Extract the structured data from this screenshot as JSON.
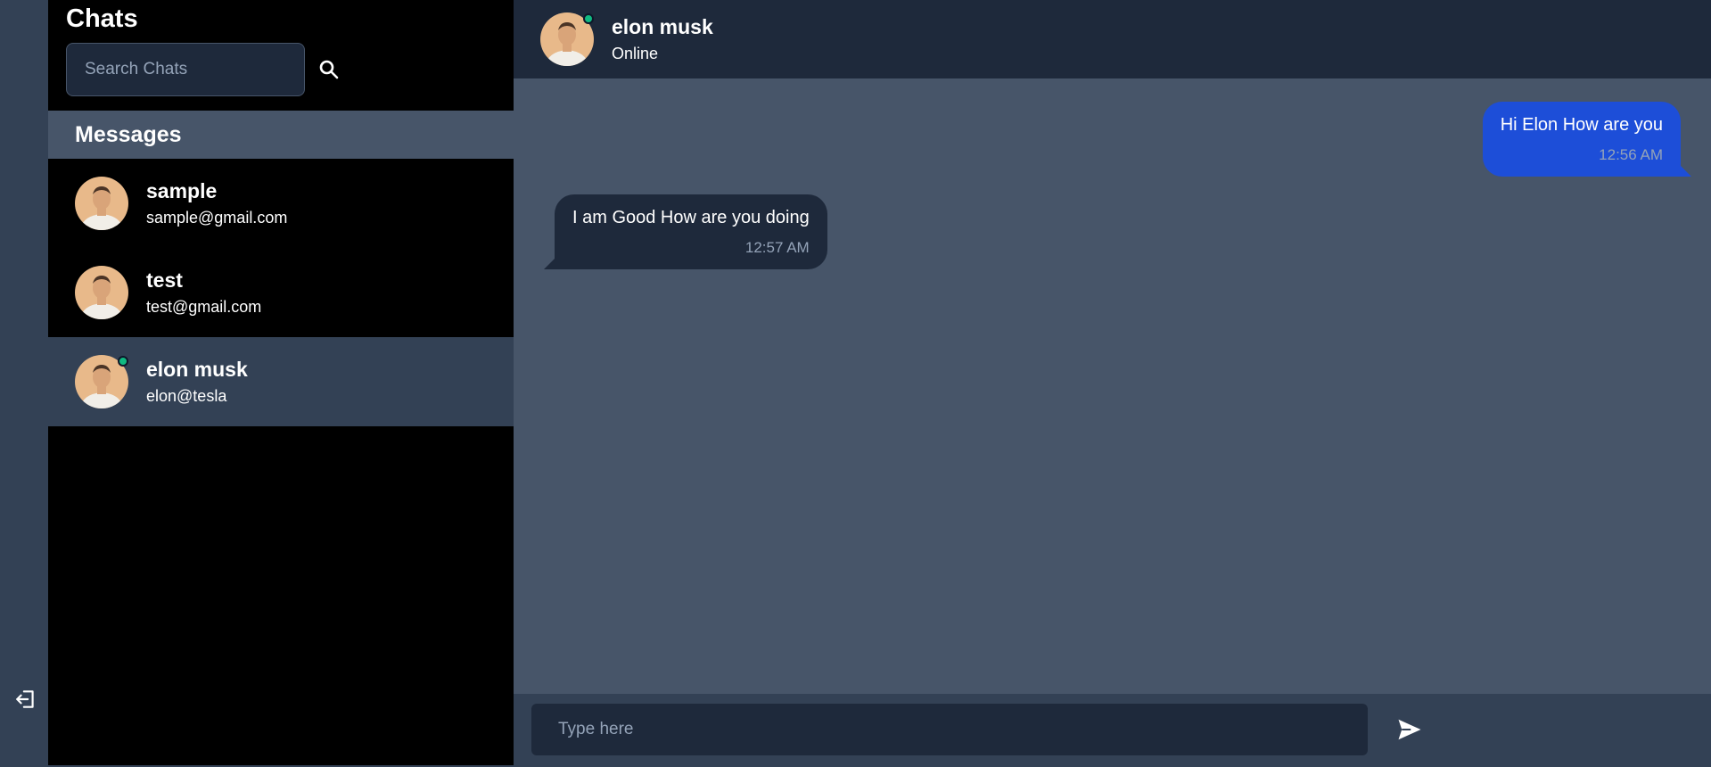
{
  "colors": {
    "rail_bg": "#334155",
    "sidebar_bg": "#000000",
    "messages_header_bg": "#475569",
    "active_contact_bg": "#334155",
    "chat_bg": "#475569",
    "chat_header_bg": "#1e293b",
    "sent_bubble": "#1d4ed8",
    "received_bubble": "#1e293b",
    "online": "#10b981"
  },
  "rail": {
    "logout_icon": "logout-icon"
  },
  "sidebar": {
    "title": "Chats",
    "search": {
      "placeholder": "Search Chats",
      "value": "",
      "icon": "search-icon"
    },
    "messages_header": "Messages",
    "contacts": [
      {
        "name": "sample",
        "email": "sample@gmail.com",
        "online": false,
        "active": false
      },
      {
        "name": "test",
        "email": "test@gmail.com",
        "online": false,
        "active": false
      },
      {
        "name": "elon musk",
        "email": "elon@tesla",
        "online": true,
        "active": true
      }
    ]
  },
  "chat": {
    "header": {
      "name": "elon musk",
      "status": "Online"
    },
    "messages": [
      {
        "direction": "sent",
        "text": "Hi Elon How are you",
        "time": "12:56 AM"
      },
      {
        "direction": "received",
        "text": "I am Good How are you doing",
        "time": "12:57 AM"
      }
    ],
    "input": {
      "placeholder": "Type here",
      "value": ""
    },
    "send_icon": "send-icon"
  }
}
